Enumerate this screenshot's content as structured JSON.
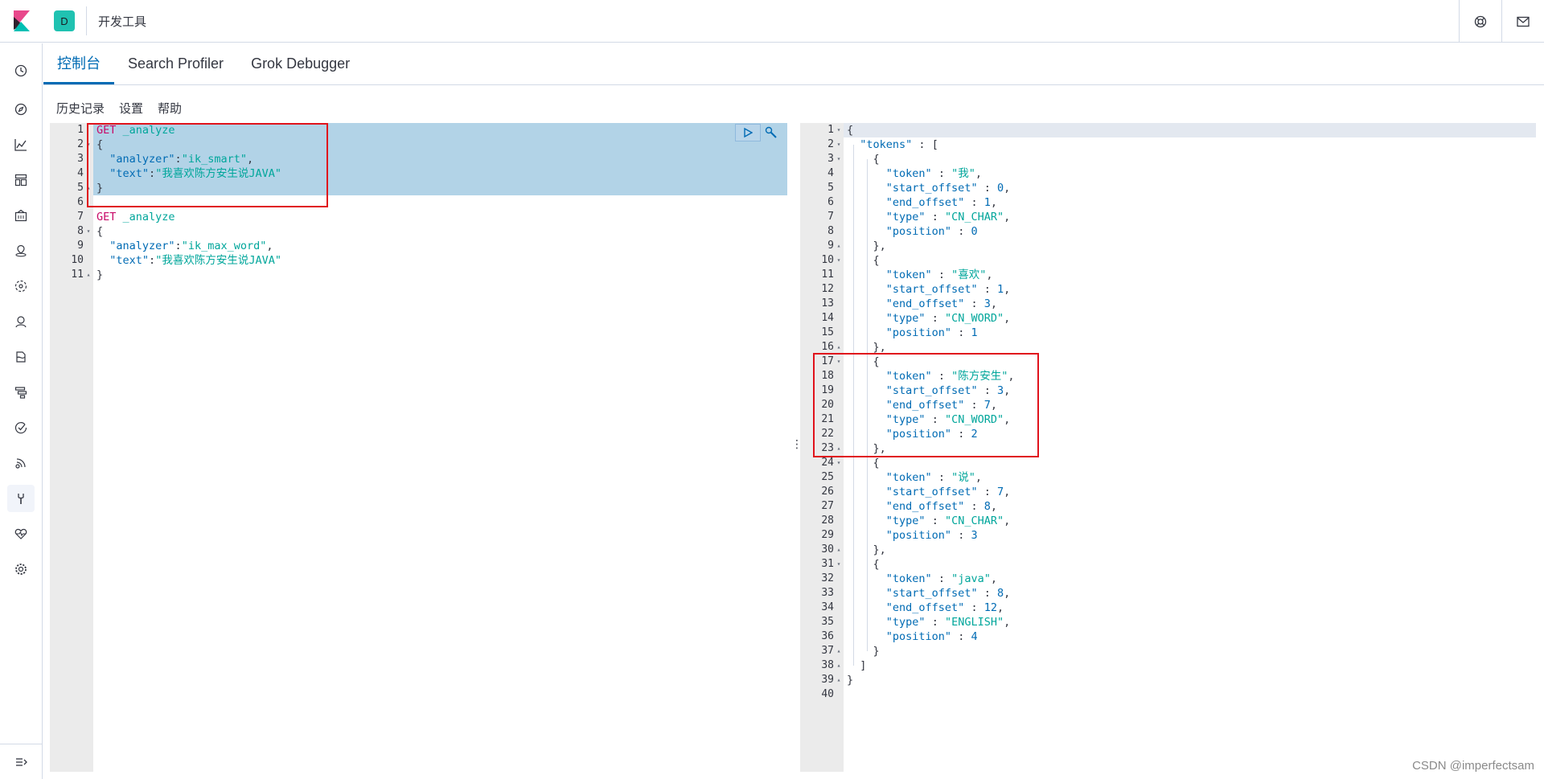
{
  "header": {
    "space_letter": "D",
    "title": "开发工具",
    "right_icons": [
      "help-icon",
      "mail-icon"
    ]
  },
  "nav": {
    "icons": [
      "clock-icon",
      "compass-icon",
      "visualize-icon",
      "dashboard-icon",
      "canvas-icon",
      "maps-icon",
      "ml-icon",
      "infra-icon",
      "logs-icon",
      "apm-icon",
      "uptime-icon",
      "siem-icon",
      "dev-tools-icon",
      "monitoring-icon",
      "settings-icon"
    ],
    "active": "dev-tools-icon",
    "collapse_icon": "collapse-menu-icon"
  },
  "tabs": [
    {
      "label": "控制台",
      "active": true
    },
    {
      "label": "Search Profiler",
      "active": false
    },
    {
      "label": "Grok Debugger",
      "active": false
    }
  ],
  "subbar": {
    "history": "历史记录",
    "settings": "设置",
    "help": "帮助"
  },
  "request_editor": {
    "lines": [
      {
        "n": "1",
        "fold": "",
        "text": "GET _analyze"
      },
      {
        "n": "2",
        "fold": "▾",
        "text": "{"
      },
      {
        "n": "3",
        "fold": "",
        "text": "  \"analyzer\":\"ik_smart\","
      },
      {
        "n": "4",
        "fold": "",
        "text": "  \"text\":\"我喜欢陈方安生说JAVA\""
      },
      {
        "n": "5",
        "fold": "▴",
        "text": "}"
      },
      {
        "n": "6",
        "fold": "",
        "text": ""
      },
      {
        "n": "7",
        "fold": "",
        "text": "GET _analyze"
      },
      {
        "n": "8",
        "fold": "▾",
        "text": "{"
      },
      {
        "n": "9",
        "fold": "",
        "text": "  \"analyzer\":\"ik_max_word\","
      },
      {
        "n": "10",
        "fold": "",
        "text": "  \"text\":\"我喜欢陈方安生说JAVA\""
      },
      {
        "n": "11",
        "fold": "▴",
        "text": "}"
      }
    ]
  },
  "response_editor": {
    "lines": [
      {
        "n": "1",
        "fold": "▾",
        "text": "{"
      },
      {
        "n": "2",
        "fold": "▾",
        "text": "  \"tokens\" : ["
      },
      {
        "n": "3",
        "fold": "▾",
        "text": "    {"
      },
      {
        "n": "4",
        "fold": "",
        "text": "      \"token\" : \"我\","
      },
      {
        "n": "5",
        "fold": "",
        "text": "      \"start_offset\" : 0,"
      },
      {
        "n": "6",
        "fold": "",
        "text": "      \"end_offset\" : 1,"
      },
      {
        "n": "7",
        "fold": "",
        "text": "      \"type\" : \"CN_CHAR\","
      },
      {
        "n": "8",
        "fold": "",
        "text": "      \"position\" : 0"
      },
      {
        "n": "9",
        "fold": "▴",
        "text": "    },"
      },
      {
        "n": "10",
        "fold": "▾",
        "text": "    {"
      },
      {
        "n": "11",
        "fold": "",
        "text": "      \"token\" : \"喜欢\","
      },
      {
        "n": "12",
        "fold": "",
        "text": "      \"start_offset\" : 1,"
      },
      {
        "n": "13",
        "fold": "",
        "text": "      \"end_offset\" : 3,"
      },
      {
        "n": "14",
        "fold": "",
        "text": "      \"type\" : \"CN_WORD\","
      },
      {
        "n": "15",
        "fold": "",
        "text": "      \"position\" : 1"
      },
      {
        "n": "16",
        "fold": "▴",
        "text": "    },"
      },
      {
        "n": "17",
        "fold": "▾",
        "text": "    {"
      },
      {
        "n": "18",
        "fold": "",
        "text": "      \"token\" : \"陈方安生\","
      },
      {
        "n": "19",
        "fold": "",
        "text": "      \"start_offset\" : 3,"
      },
      {
        "n": "20",
        "fold": "",
        "text": "      \"end_offset\" : 7,"
      },
      {
        "n": "21",
        "fold": "",
        "text": "      \"type\" : \"CN_WORD\","
      },
      {
        "n": "22",
        "fold": "",
        "text": "      \"position\" : 2"
      },
      {
        "n": "23",
        "fold": "▴",
        "text": "    },"
      },
      {
        "n": "24",
        "fold": "▾",
        "text": "    {"
      },
      {
        "n": "25",
        "fold": "",
        "text": "      \"token\" : \"说\","
      },
      {
        "n": "26",
        "fold": "",
        "text": "      \"start_offset\" : 7,"
      },
      {
        "n": "27",
        "fold": "",
        "text": "      \"end_offset\" : 8,"
      },
      {
        "n": "28",
        "fold": "",
        "text": "      \"type\" : \"CN_CHAR\","
      },
      {
        "n": "29",
        "fold": "",
        "text": "      \"position\" : 3"
      },
      {
        "n": "30",
        "fold": "▴",
        "text": "    },"
      },
      {
        "n": "31",
        "fold": "▾",
        "text": "    {"
      },
      {
        "n": "32",
        "fold": "",
        "text": "      \"token\" : \"java\","
      },
      {
        "n": "33",
        "fold": "",
        "text": "      \"start_offset\" : 8,"
      },
      {
        "n": "34",
        "fold": "",
        "text": "      \"end_offset\" : 12,"
      },
      {
        "n": "35",
        "fold": "",
        "text": "      \"type\" : \"ENGLISH\","
      },
      {
        "n": "36",
        "fold": "",
        "text": "      \"position\" : 4"
      },
      {
        "n": "37",
        "fold": "▴",
        "text": "    }"
      },
      {
        "n": "38",
        "fold": "▴",
        "text": "  ]"
      },
      {
        "n": "39",
        "fold": "▴",
        "text": "}"
      },
      {
        "n": "40",
        "fold": "",
        "text": ""
      }
    ]
  },
  "watermark": "CSDN @imperfectsam",
  "colors": {
    "accent": "#006bb4",
    "method": "#c80a68",
    "string": "#00a69b",
    "selection": "#b2d3e7",
    "highlight_box": "#e0131c",
    "space_badge": "#20c2b1"
  }
}
